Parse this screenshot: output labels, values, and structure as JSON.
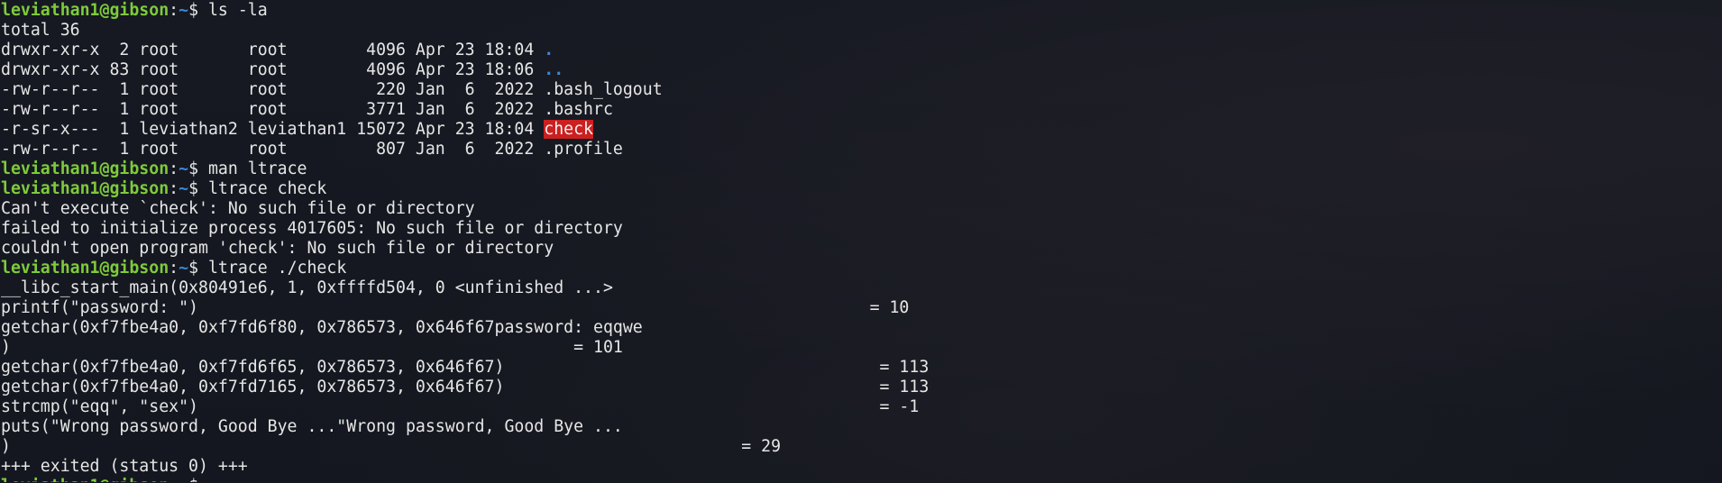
{
  "prompt": {
    "user_host": "leviathan1@gibson",
    "colon": ":",
    "path": "~",
    "symbol": "$ "
  },
  "commands": {
    "ls": "ls -la",
    "man": "man ltrace",
    "ltrace1": "ltrace check",
    "ltrace2": "ltrace ./check"
  },
  "listing": {
    "total": "total 36",
    "rows": [
      {
        "meta": "drwxr-xr-x  2 root       root        4096 Apr 23 18:04 ",
        "name": "."
      },
      {
        "meta": "drwxr-xr-x 83 root       root        4096 Apr 23 18:06 ",
        "name": ".."
      },
      {
        "meta": "-rw-r--r--  1 root       root         220 Jan  6  2022 ",
        "name": ".bash_logout"
      },
      {
        "meta": "-rw-r--r--  1 root       root        3771 Jan  6  2022 ",
        "name": ".bashrc"
      },
      {
        "meta": "-r-sr-x---  1 leviathan2 leviathan1 15072 Apr 23 18:04 ",
        "name": "check"
      },
      {
        "meta": "-rw-r--r--  1 root       root         807 Jan  6  2022 ",
        "name": ".profile"
      }
    ]
  },
  "errors": [
    "Can't execute `check': No such file or directory",
    "failed to initialize process 4017605: No such file or directory",
    "couldn't open program 'check': No such file or directory"
  ],
  "trace": [
    "__libc_start_main(0x80491e6, 1, 0xffffd504, 0 <unfinished ...>",
    "printf(\"password: \")                                                                    = 10",
    "getchar(0xf7fbe4a0, 0xf7fd6f80, 0x786573, 0x646f67password: eqqwe",
    ")                                                         = 101",
    "getchar(0xf7fbe4a0, 0xf7fd6f65, 0x786573, 0x646f67)                                      = 113",
    "getchar(0xf7fbe4a0, 0xf7fd7165, 0x786573, 0x646f67)                                      = 113",
    "strcmp(\"eqq\", \"sex\")                                                                     = -1",
    "puts(\"Wrong password, Good Bye ...\"Wrong password, Good Bye ...",
    ")                                                                          = 29",
    "+++ exited (status 0) +++"
  ]
}
